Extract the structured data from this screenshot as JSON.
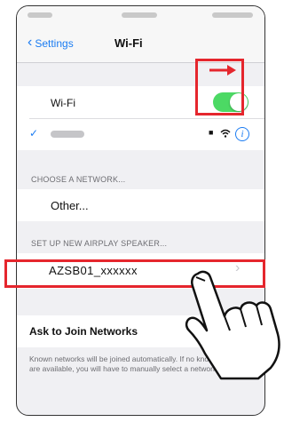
{
  "nav": {
    "back_label": "Settings",
    "title": "Wi-Fi"
  },
  "wifi": {
    "label": "Wi-Fi",
    "enabled": true
  },
  "connected_network": {
    "checkmark": "✓",
    "lock_glyph": "🔒",
    "info_glyph": "i"
  },
  "networks_section": {
    "header": "CHOOSE A NETWORK...",
    "other_label": "Other..."
  },
  "airplay_section": {
    "header": "SET UP NEW AIRPLAY SPEAKER...",
    "device_name": "AZSB01_xxxxxx",
    "chevron": "›"
  },
  "ask_join": {
    "label": "Ask to Join Networks",
    "description": "Known networks will be joined automatically. If no known networks are available, you will have to manually select a network."
  },
  "colors": {
    "accent": "#1b7cf2",
    "toggle_on": "#4cd964",
    "highlight": "#e5262d"
  }
}
